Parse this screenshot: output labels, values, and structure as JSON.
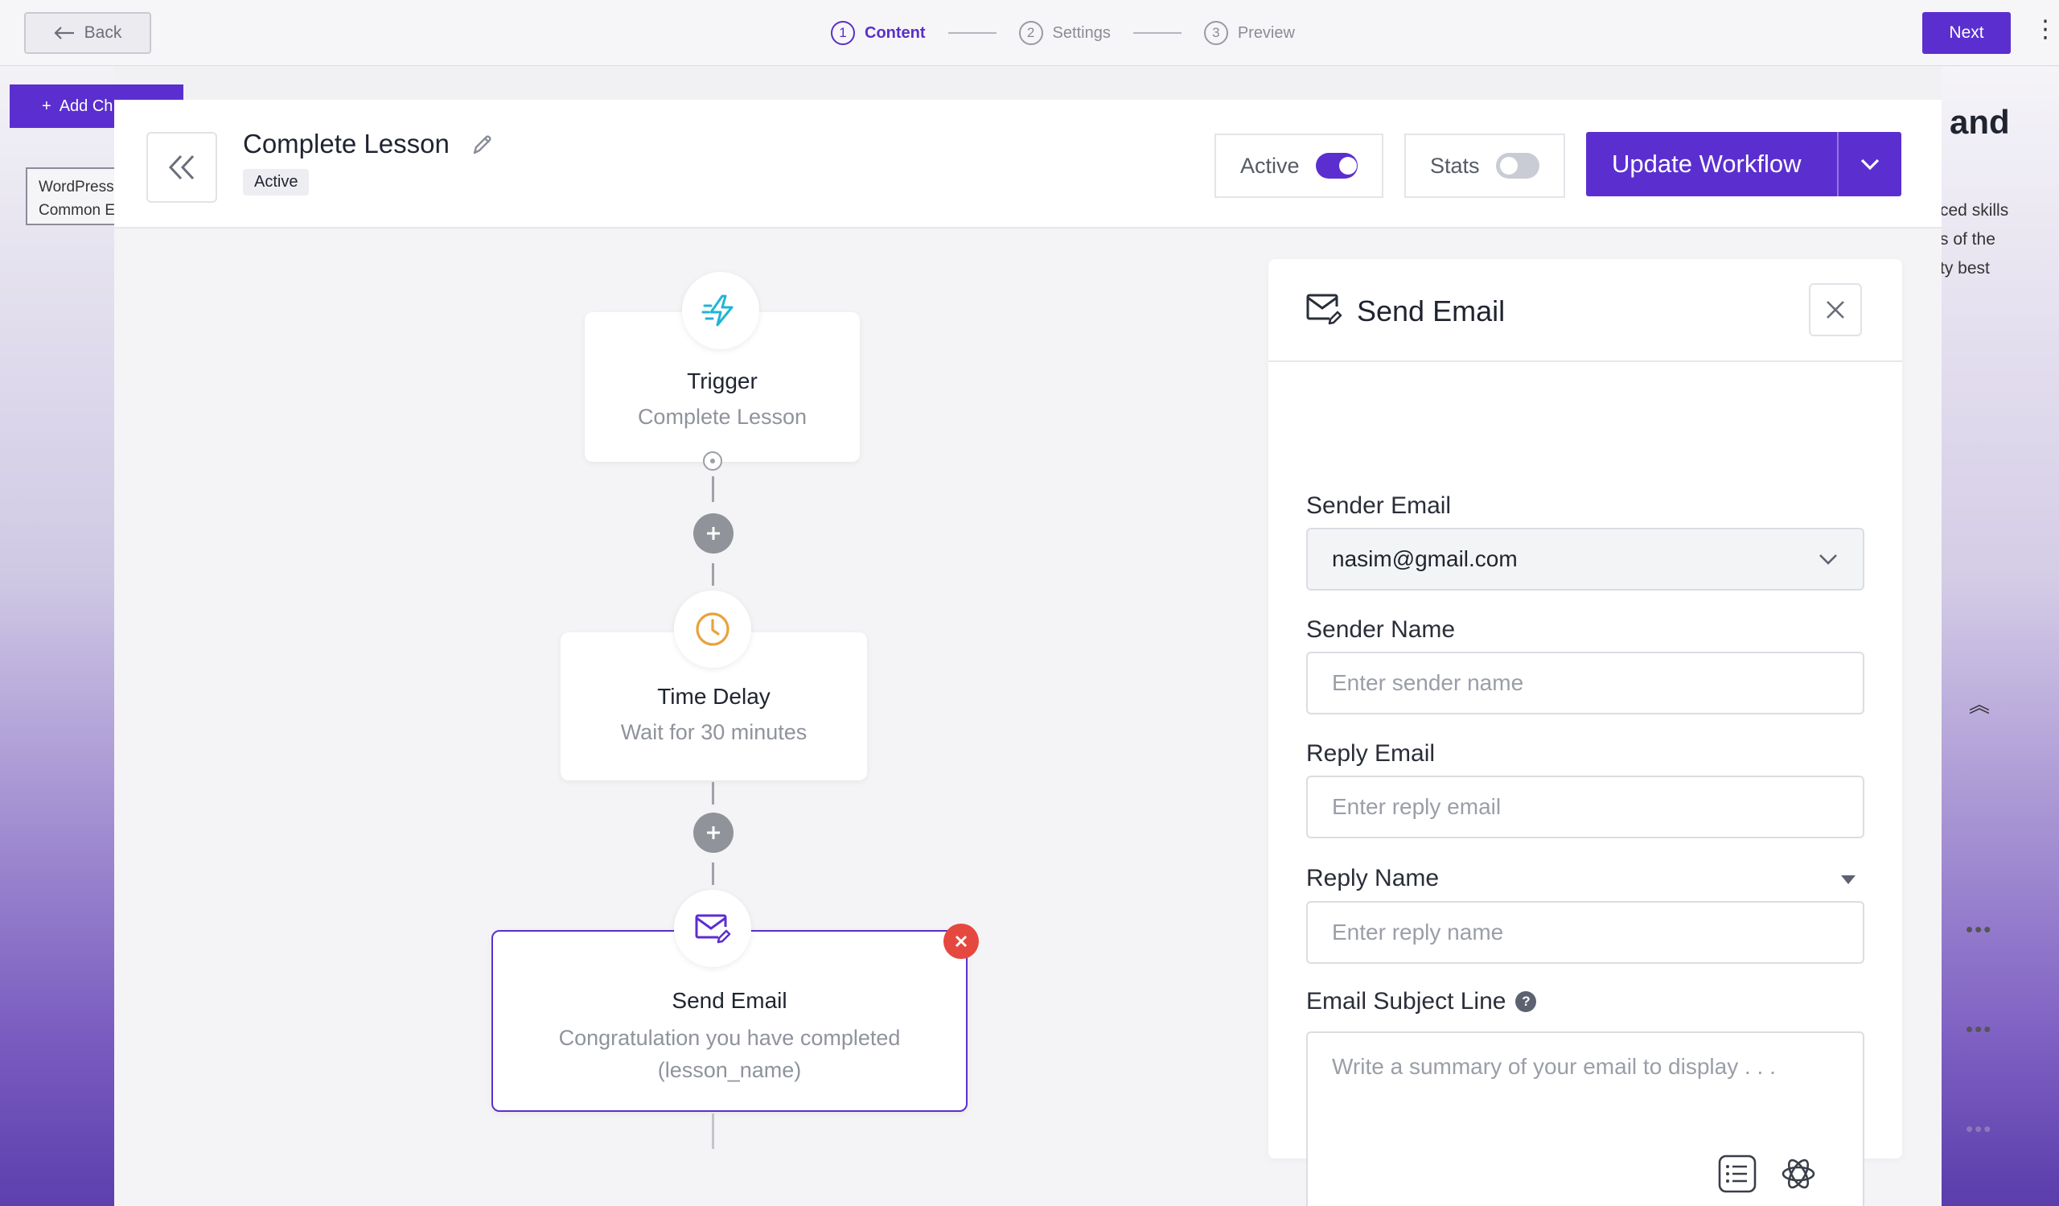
{
  "topbar": {
    "back_label": "Back",
    "steps": [
      {
        "num": "1",
        "label": "Content"
      },
      {
        "num": "2",
        "label": "Settings"
      },
      {
        "num": "3",
        "label": "Preview"
      }
    ],
    "next_label": "Next"
  },
  "background": {
    "add_label": "Add Ch",
    "card_lines": [
      "WordPress",
      "Common E"
    ],
    "right_title": "and",
    "right_lines": [
      "ced skills",
      "s of the",
      "ty best"
    ]
  },
  "workflow": {
    "title": "Complete Lesson",
    "badge": "Active",
    "active_toggle_label": "Active",
    "active_on": true,
    "stats_toggle_label": "Stats",
    "stats_on": false,
    "update_label": "Update Workflow"
  },
  "nodes": [
    {
      "title": "Trigger",
      "subtitle": "Complete Lesson",
      "icon": "lightning-icon"
    },
    {
      "title": "Time Delay",
      "subtitle": "Wait for 30 minutes",
      "icon": "clock-icon"
    },
    {
      "title": "Send Email",
      "subtitle_line1": "Congratulation you have completed",
      "subtitle_line2": "(lesson_name)",
      "icon": "email-edit-icon"
    }
  ],
  "panel": {
    "title": "Send Email",
    "sender_email_label": "Sender Email",
    "sender_email_value": "nasim@gmail.com",
    "sender_name_label": "Sender Name",
    "sender_name_placeholder": "Enter sender name",
    "reply_email_label": "Reply Email",
    "reply_email_placeholder": "Enter reply email",
    "reply_name_label": "Reply Name",
    "reply_name_placeholder": "Enter reply name",
    "subject_label": "Email Subject Line",
    "subject_help": "?",
    "subject_placeholder": "Write a summary of your email to display . . ."
  },
  "colors": {
    "brand": "#5b2fcf",
    "danger": "#e5483f",
    "trigger_icon": "#1fb5d6",
    "delay_icon": "#e9a23b"
  }
}
